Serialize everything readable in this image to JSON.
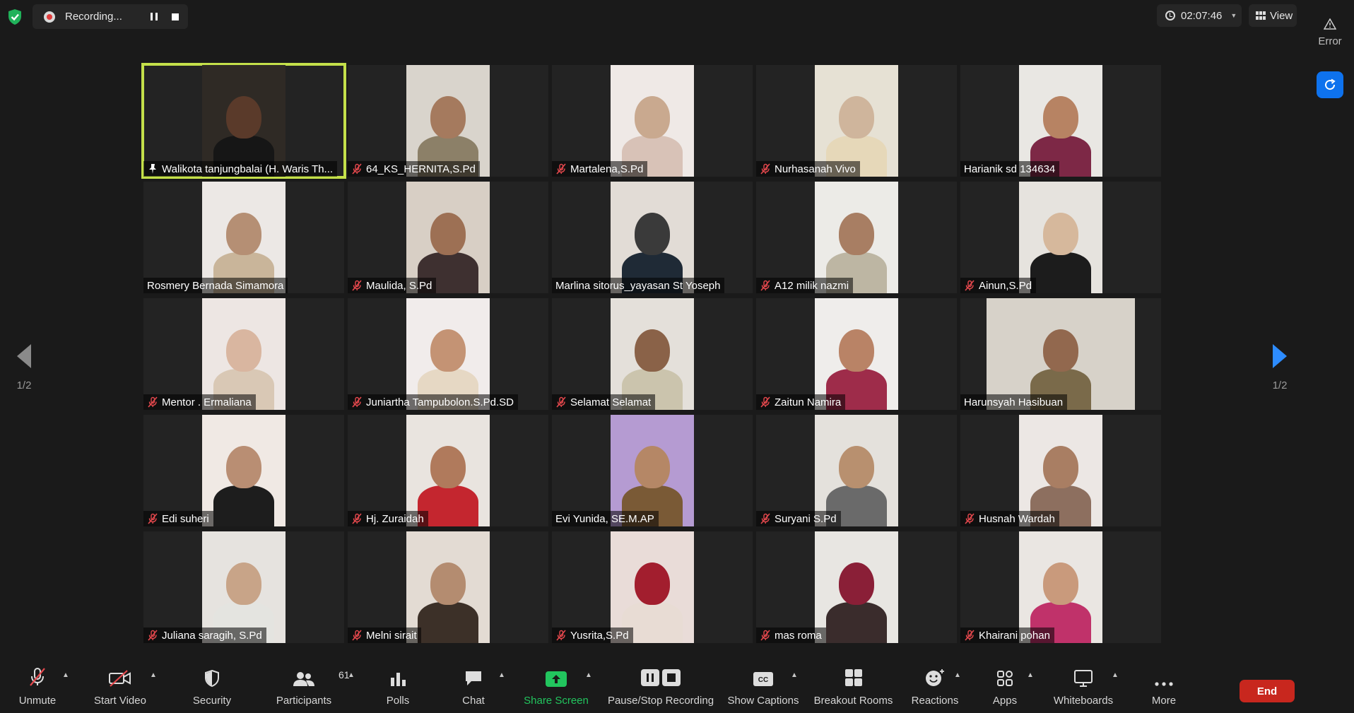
{
  "recording": {
    "status": "Recording..."
  },
  "timer": {
    "value": "02:07:46"
  },
  "view": {
    "label": "View"
  },
  "error": {
    "label": "Error"
  },
  "pagination": {
    "left": "1/2",
    "right": "1/2"
  },
  "participants": [
    {
      "name": "Walikota tanjungbalai (H. Waris Th...",
      "muted": false,
      "active": true,
      "bg": "#2f2a25",
      "head": "#5a3a2a",
      "body": "#161616"
    },
    {
      "name": "64_KS_HERNITA,S.Pd",
      "muted": true,
      "bg": "#d9d4cc",
      "head": "#a57a5e",
      "body": "#8c8068"
    },
    {
      "name": "Martalena,S.Pd",
      "muted": true,
      "bg": "#efe9e6",
      "head": "#c9a98f",
      "body": "#d8c2b7"
    },
    {
      "name": "Nurhasanah Vivo",
      "muted": true,
      "bg": "#e6e1d4",
      "head": "#cfb59c",
      "body": "#e6d8b9"
    },
    {
      "name": "Harianik sd 134634",
      "muted": false,
      "bg": "#e9e7e3",
      "head": "#b78363",
      "body": "#7d2846"
    },
    {
      "name": "Rosmery Bernada Simamora",
      "muted": false,
      "bg": "#ece8e5",
      "head": "#b58f74",
      "body": "#c9b59a"
    },
    {
      "name": "Maulida, S.Pd",
      "muted": true,
      "bg": "#d8cfc5",
      "head": "#9d7054",
      "body": "#3e3030"
    },
    {
      "name": "Marlina sitorus_yayasan St Yoseph",
      "muted": false,
      "bg": "#e2dcd6",
      "head": "#3a3a3a",
      "body": "#1f2a36"
    },
    {
      "name": "A12 milik nazmi",
      "muted": true,
      "bg": "#ecebe7",
      "head": "#a87e63",
      "body": "#bdb6a3"
    },
    {
      "name": "Ainun,S.Pd",
      "muted": true,
      "bg": "#e6e3de",
      "head": "#d6b89c",
      "body": "#1c1c1c"
    },
    {
      "name": "Mentor . Ermaliana",
      "muted": true,
      "bg": "#ede6e3",
      "head": "#d9b6a0",
      "body": "#d9c8b5"
    },
    {
      "name": "Juniartha Tampubolon.S.Pd.SD",
      "muted": true,
      "bg": "#f1eceb",
      "head": "#c49374",
      "body": "#e6d8c4"
    },
    {
      "name": "Selamat Selamat",
      "muted": true,
      "bg": "#e4e0da",
      "head": "#8a6248",
      "body": "#cbc4ad"
    },
    {
      "name": "Zaitun Namira",
      "muted": true,
      "bg": "#efedeb",
      "head": "#b98366",
      "body": "#9e2c4a"
    },
    {
      "name": "Harunsyah Hasibuan",
      "muted": false,
      "wide": true,
      "bg": "#d7d2c9",
      "head": "#92684e",
      "body": "#7a6a4a"
    },
    {
      "name": "Edi suheri",
      "muted": true,
      "bg": "#f0e9e4",
      "head": "#b98e73",
      "body": "#1d1d1d"
    },
    {
      "name": "Hj. Zuraidah",
      "muted": true,
      "bg": "#e9e4df",
      "head": "#b07a5c",
      "body": "#c4262f"
    },
    {
      "name": "Evi Yunida, SE.M.AP",
      "muted": false,
      "bg": "#b59bd2",
      "head": "#b58766",
      "body": "#7a5a36"
    },
    {
      "name": "Suryani S.Pd",
      "muted": true,
      "bg": "#e4e1dc",
      "head": "#b8906f",
      "body": "#6a6a6a"
    },
    {
      "name": "Husnah Wardah",
      "muted": true,
      "bg": "#ece7e4",
      "head": "#a97e63",
      "body": "#8d6f5f"
    },
    {
      "name": "Juliana saragih, S.Pd",
      "muted": true,
      "bg": "#e6e3df",
      "head": "#c8a488",
      "body": "#e4e4e0"
    },
    {
      "name": "Melni sirait",
      "muted": true,
      "bg": "#e3dbd3",
      "head": "#b48c70",
      "body": "#3c3028"
    },
    {
      "name": "Yusrita,S.Pd",
      "muted": true,
      "bg": "#e9dcd8",
      "head": "#a21e2e",
      "body": "#e8dcd4"
    },
    {
      "name": "mas roma",
      "muted": true,
      "bg": "#e8e6e2",
      "head": "#8a1f37",
      "body": "#3a2c2c"
    },
    {
      "name": "Khairani pohan",
      "muted": true,
      "bg": "#eae6e2",
      "head": "#c99a7c",
      "body": "#c0326a"
    }
  ],
  "toolbar": {
    "unmute": "Unmute",
    "start_video": "Start Video",
    "security": "Security",
    "participants": "Participants",
    "participants_count": "61",
    "polls": "Polls",
    "chat": "Chat",
    "share_screen": "Share Screen",
    "pause_stop_recording": "Pause/Stop Recording",
    "show_captions": "Show Captions",
    "breakout_rooms": "Breakout Rooms",
    "reactions": "Reactions",
    "apps": "Apps",
    "whiteboards": "Whiteboards",
    "more": "More",
    "end": "End"
  },
  "colors": {
    "active_speaker": "#c4e04a",
    "share_green": "#22c55e",
    "end_red": "#c8271e",
    "accent_blue": "#0e72ed",
    "muted_red": "#e5484d"
  }
}
